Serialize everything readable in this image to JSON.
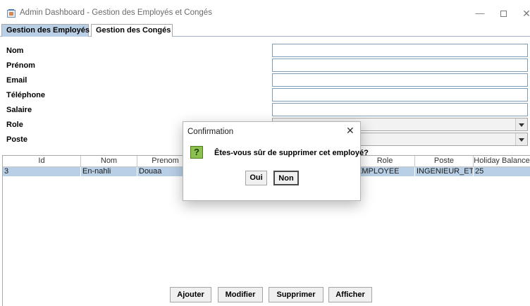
{
  "window": {
    "title": "Admin Dashboard - Gestion des Employés et Congés",
    "minimize_glyph": "—",
    "close_glyph": "✕"
  },
  "tabs": [
    {
      "label": "Gestion des Employés",
      "active": true
    },
    {
      "label": "Gestion des Congés",
      "active": false
    }
  ],
  "form": {
    "fields": [
      {
        "label": "Nom",
        "value": ""
      },
      {
        "label": "Prénom",
        "value": ""
      },
      {
        "label": "Email",
        "value": ""
      },
      {
        "label": "Téléphone",
        "value": ""
      },
      {
        "label": "Salaire",
        "value": ""
      },
      {
        "label": "Role",
        "value": ""
      },
      {
        "label": "Poste",
        "value": ""
      }
    ]
  },
  "table": {
    "columns": [
      "Id",
      "Nom",
      "Prenom",
      "",
      "",
      "Role",
      "Poste",
      "Holiday Balance"
    ],
    "rows": [
      [
        "3",
        "En-nahli",
        "Douaa",
        "",
        "",
        "EMPLOYEE",
        "INGENIEUR_ET...",
        "25"
      ]
    ]
  },
  "actions": {
    "ajouter": "Ajouter",
    "modifier": "Modifier",
    "supprimer": "Supprimer",
    "afficher": "Afficher"
  },
  "dialog": {
    "title": "Confirmation",
    "close_glyph": "✕",
    "icon_glyph": "?",
    "message": "Êtes-vous sûr de supprimer cet employé?",
    "yes": "Oui",
    "no": "Non"
  },
  "colors": {
    "selection": "#b8cfe5",
    "question_icon": "#8cc04f"
  }
}
